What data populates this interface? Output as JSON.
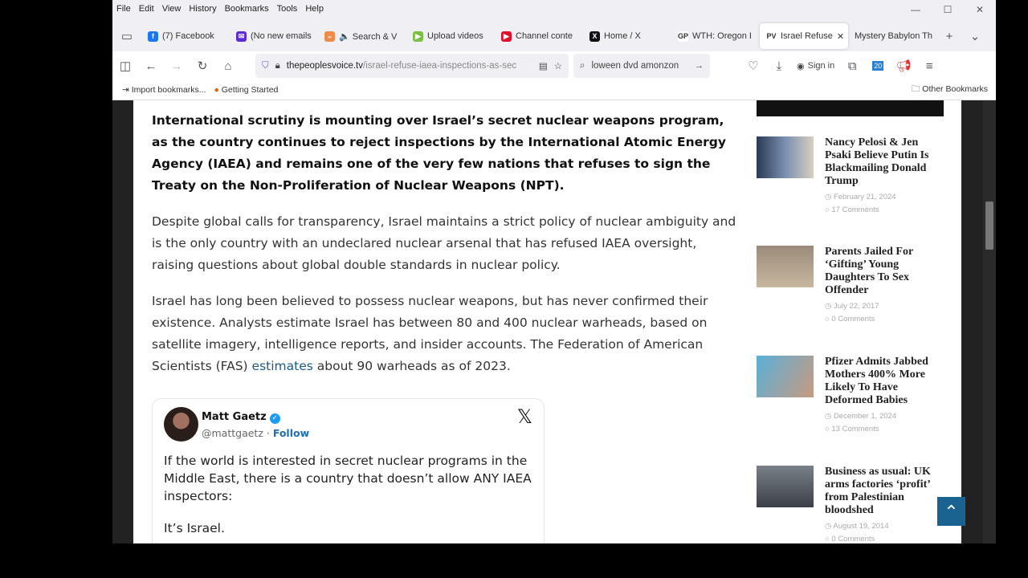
{
  "menu": [
    "File",
    "Edit",
    "View",
    "History",
    "Bookmarks",
    "Tools",
    "Help"
  ],
  "tabs": [
    {
      "label": "(7) Facebook",
      "color": "#1877f2",
      "glyph": "f"
    },
    {
      "label": "(No new emails",
      "color": "#5b2bd6",
      "glyph": "✉"
    },
    {
      "label": "🔈 Search & V",
      "color": "#f08a4b",
      "glyph": "◒"
    },
    {
      "label": "Upload videos",
      "color": "#7bc043",
      "glyph": "▶"
    },
    {
      "label": "Channel conte",
      "color": "#e0102a",
      "glyph": "▶"
    },
    {
      "label": "Home / X",
      "color": "#111",
      "glyph": "X"
    },
    {
      "label": "WTH: Oregon I",
      "color": "#fff",
      "glyph": "GP"
    },
    {
      "label": "Israel Refuse",
      "color": "#fff",
      "glyph": "PV"
    },
    {
      "label": "Mystery Babylon Th",
      "color": "#fff",
      "glyph": ""
    }
  ],
  "nav": {
    "url_host": "thepeoplesvoice.tv",
    "url_path": "/israel-refuse-iaea-inspections-as-sec",
    "search": "loween dvd amonzon",
    "signin": "Sign in",
    "badge": "20"
  },
  "bookmarks": {
    "import": "Import bookmarks...",
    "getting_started": "Getting Started",
    "other": "Other Bookmarks"
  },
  "article": {
    "p1": "International scrutiny is mounting over Israel’s secret nuclear weapons program, as the country continues to reject inspections by the International Atomic Energy Agency (IAEA) and remains one of the very few nations that refuses to sign the Treaty on the Non-Proliferation of Nuclear Weapons (NPT).",
    "p2": "Despite global calls for transparency, Israel maintains a strict policy of nuclear ambiguity and is the only country with an undeclared nuclear arsenal that has refused IAEA oversight, raising questions about global double standards in nuclear policy.",
    "p3a": "Israel has long been believed to possess nuclear weapons, but has never confirmed their existence. Analysts estimate Israel has between 80 and 400 nuclear warheads, based on satellite imagery, intelligence reports, and insider accounts. The Federation of American Scientists (FAS) ",
    "p3link": "estimates",
    "p3b": " about 90 warheads as of 2023."
  },
  "tweet": {
    "name": "Matt Gaetz",
    "handle": "@mattgaetz · ",
    "follow": "Follow",
    "text": "If the world is interested in secret nuclear programs in the Middle East, there is a country that doesn’t allow ANY IAEA inspectors:",
    "text2": "It’s Israel."
  },
  "sidebar": [
    {
      "title": "Nancy Pelosi & Jen Psaki Believe Putin Is Blackmailing Donald Trump",
      "date": "February 21, 2024",
      "comments": "17 Comments"
    },
    {
      "title": "Parents Jailed For ‘Gifting’ Young Daughters To Sex Offender",
      "date": "July 22, 2017",
      "comments": "0 Comments"
    },
    {
      "title": "Pfizer Admits Jabbed Mothers 400% More Likely To Have Deformed Babies",
      "date": "December 1, 2024",
      "comments": "13 Comments"
    },
    {
      "title": "Business as usual: UK arms factories ‘profit’ from Palestinian bloodshed",
      "date": "August 19, 2014",
      "comments": "0 Comments"
    }
  ]
}
